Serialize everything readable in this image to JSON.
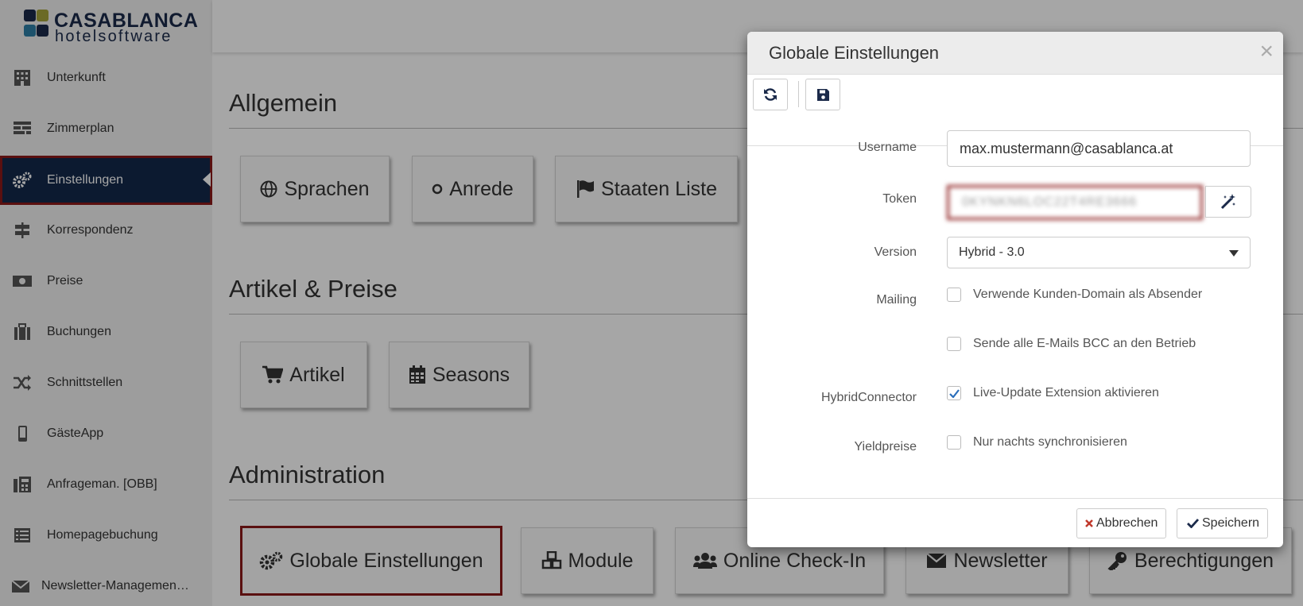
{
  "brand": {
    "line1": "CASABLANCA",
    "line2": "hotelsoftware"
  },
  "sidebar": {
    "items": [
      {
        "label": "Unterkunft",
        "icon": "building-icon"
      },
      {
        "label": "Zimmerplan",
        "icon": "grid-plan-icon"
      },
      {
        "label": "Einstellungen",
        "icon": "cogs-icon",
        "active": true
      },
      {
        "label": "Korrespondenz",
        "icon": "signpost-icon"
      },
      {
        "label": "Preise",
        "icon": "money-icon"
      },
      {
        "label": "Buchungen",
        "icon": "suitcase-icon"
      },
      {
        "label": "Schnittstellen",
        "icon": "random-icon"
      },
      {
        "label": "GästeApp",
        "icon": "mobile-icon"
      },
      {
        "label": "Anfrageman. [OBB]",
        "icon": "fax-icon"
      },
      {
        "label": "Homepagebuchung",
        "icon": "list-icon"
      },
      {
        "label": "Newsletter-Managemen…",
        "icon": "envelope-icon"
      }
    ]
  },
  "sections": {
    "allgemein": {
      "title": "Allgemein",
      "tiles": [
        "Sprachen",
        "Anrede",
        "Staaten Liste"
      ]
    },
    "artikel": {
      "title": "Artikel & Preise",
      "tiles": [
        "Artikel",
        "Seasons"
      ]
    },
    "admin": {
      "title": "Administration",
      "tiles": [
        "Globale Einstellungen",
        "Module",
        "Online Check-In",
        "Newsletter",
        "Berechtigungen"
      ]
    }
  },
  "modal": {
    "title": "Globale Einstellungen",
    "close": "×",
    "fields": {
      "username_label": "Username",
      "username_value": "max.mustermann@casablanca.at",
      "token_label": "Token",
      "token_value": "0KYNKN6LOC22T4RE3666",
      "version_label": "Version",
      "version_value": "Hybrid - 3.0",
      "mailing_label": "Mailing",
      "mailing_opt1": "Verwende Kunden-Domain als Absender",
      "mailing_opt2": "Sende alle E-Mails BCC an den Betrieb",
      "hybrid_label": "HybridConnector",
      "hybrid_opt": "Live-Update Extension aktivieren",
      "yield_label": "Yieldpreise",
      "yield_opt": "Nur nachts synchronisieren"
    },
    "checkboxes": {
      "mailing_opt1": false,
      "mailing_opt2": false,
      "hybrid_opt": true,
      "yield_opt": false
    },
    "footer": {
      "cancel": "Abbrechen",
      "save": "Speichern"
    }
  },
  "colors": {
    "sidebar_active": "#13294b",
    "highlight": "#8b1a1a",
    "check": "#2a6ebb"
  }
}
